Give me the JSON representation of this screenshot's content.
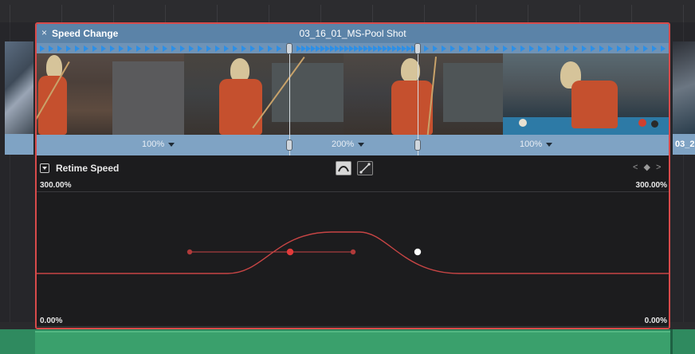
{
  "timeline": {
    "clip": {
      "effect_title": "Speed Change",
      "close_symbol": "×",
      "name": "03_16_01_MS-Pool Shot",
      "segments": [
        {
          "speed": "100%"
        },
        {
          "speed": "200%"
        },
        {
          "speed": "100%"
        }
      ]
    },
    "next_clip": {
      "name": "03_2"
    }
  },
  "retime": {
    "label": "Retime Speed",
    "nav": "< ◆ >",
    "top_left": "300.00%",
    "top_right": "300.00%",
    "bottom_left": "0.00%",
    "bottom_right": "0.00%",
    "curve_color": "#c84545",
    "active_keyframe_color": "#e23a3a",
    "selected_keyframe_color": "#ffffff"
  }
}
